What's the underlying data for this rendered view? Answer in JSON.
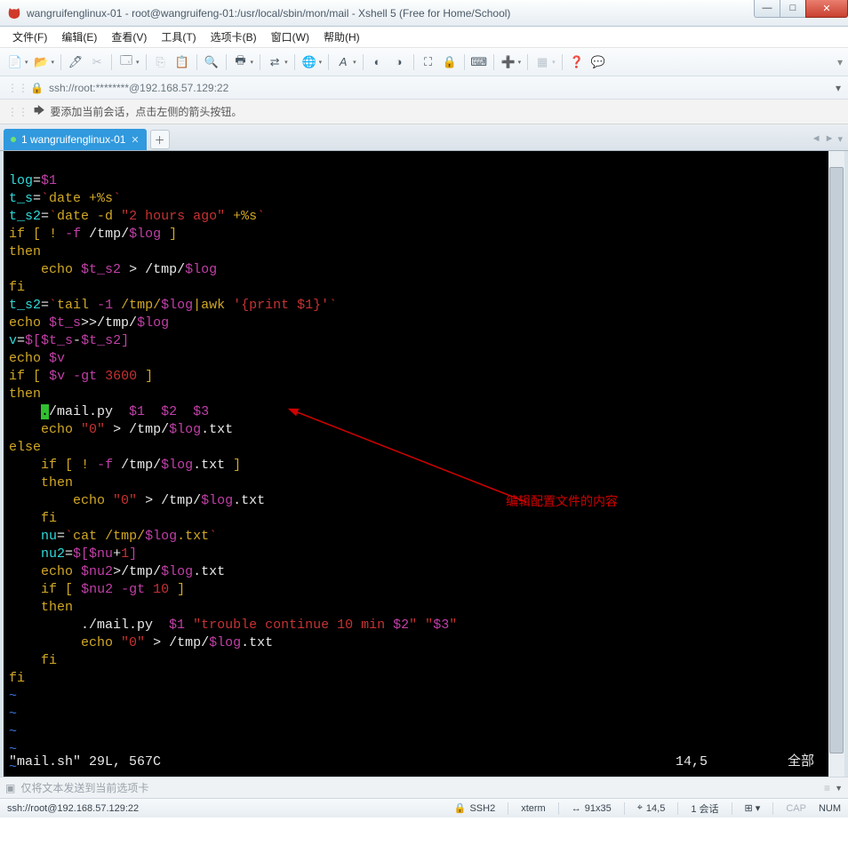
{
  "window": {
    "title": "wangruifenglinux-01 - root@wangruifeng-01:/usr/local/sbin/mon/mail - Xshell 5 (Free for Home/School)"
  },
  "menu": {
    "file": "文件(F)",
    "edit": "编辑(E)",
    "view": "查看(V)",
    "tools": "工具(T)",
    "tab": "选项卡(B)",
    "window": "窗口(W)",
    "help": "帮助(H)"
  },
  "address": {
    "text": "ssh://root:********@192.168.57.129:22"
  },
  "infobar": {
    "text": "要添加当前会话，点击左侧的箭头按钮。"
  },
  "tabs": {
    "active": "1 wangruifenglinux-01"
  },
  "terminal": {
    "status_line_left": "\"mail.sh\" 29L, 567C",
    "status_line_pos": "14,5",
    "status_line_right": "全部"
  },
  "annotation": {
    "text": "编辑配置文件的内容"
  },
  "bottominput": {
    "placeholder": "仅将文本发送到当前选项卡"
  },
  "status": {
    "conn": "ssh://root@192.168.57.129:22",
    "proto": "SSH2",
    "term": "xterm",
    "size": "91x35",
    "cursor": "14,5",
    "sessions": "1 会话",
    "cap": "CAP",
    "num": "NUM"
  }
}
